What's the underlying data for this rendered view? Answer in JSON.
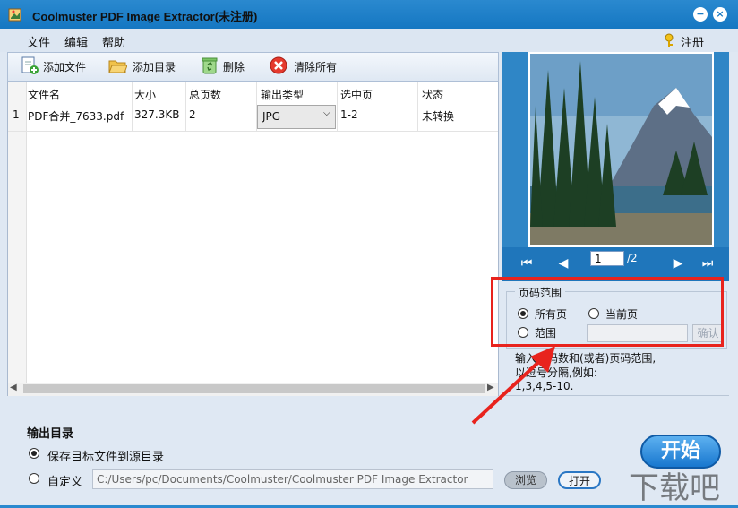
{
  "window": {
    "title": "Coolmuster PDF Image Extractor(未注册)",
    "minimize": "−",
    "close": "×"
  },
  "menu": {
    "items": [
      "文件",
      "编辑",
      "帮助"
    ],
    "register": "注册"
  },
  "toolbar": {
    "add_file": "添加文件",
    "add_folder": "添加目录",
    "delete": "删除",
    "clear_all": "清除所有"
  },
  "table": {
    "headers": [
      "文件名",
      "大小",
      "总页数",
      "输出类型",
      "选中页",
      "状态"
    ],
    "rows": [
      {
        "index": "1",
        "name": "PDF合并_7633.pdf",
        "size": "327.3KB",
        "pages": "2",
        "type": "JPG",
        "selected": "1-2",
        "status": "未转换"
      }
    ]
  },
  "preview": {
    "page": "1",
    "total": "/2"
  },
  "page_range": {
    "title": "页码范围",
    "all_pages": "所有页",
    "current_page": "当前页",
    "range": "范围",
    "range_value": "",
    "confirm": "确认",
    "selected": "all",
    "hint_line1": "输入页码数和(或者)页码范围,",
    "hint_line2": "以逗号分隔,例如:",
    "hint_line3": "1,3,4,5-10."
  },
  "output": {
    "title": "输出目录",
    "save_source": "保存目标文件到源目录",
    "custom": "自定义",
    "path": "C:/Users/pc/Documents/Coolmuster/Coolmuster PDF Image Extractor",
    "browse": "浏览",
    "open": "打开",
    "selected": "source"
  },
  "start": "开始",
  "watermark": "下载吧",
  "colors": {
    "accent": "#1577c2",
    "highlight": "#e8231d"
  }
}
